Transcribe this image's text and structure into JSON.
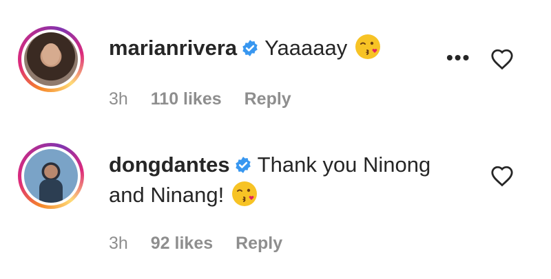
{
  "comments": [
    {
      "username": "marianrivera",
      "text": "Yaaaaay",
      "emoji": "kissing-face-emoji",
      "time": "3h",
      "likes": "110 likes",
      "reply": "Reply",
      "more": "•••",
      "icons": {
        "verified": "verified-badge-icon",
        "like": "heart-icon",
        "more": "more-options-icon"
      }
    },
    {
      "username": "dongdantes",
      "text": "Thank you Ninong",
      "text_line2": "and Ninang!",
      "emoji": "kissing-face-emoji",
      "time": "3h",
      "likes": "92 likes",
      "reply": "Reply",
      "icons": {
        "verified": "verified-badge-icon",
        "like": "heart-icon"
      }
    }
  ],
  "colors": {
    "verified_blue": "#3897f0",
    "meta_gray": "#8e8e8e",
    "text": "#262626",
    "emoji_yellow": "#f7c325",
    "emoji_heart": "#e0245e"
  }
}
